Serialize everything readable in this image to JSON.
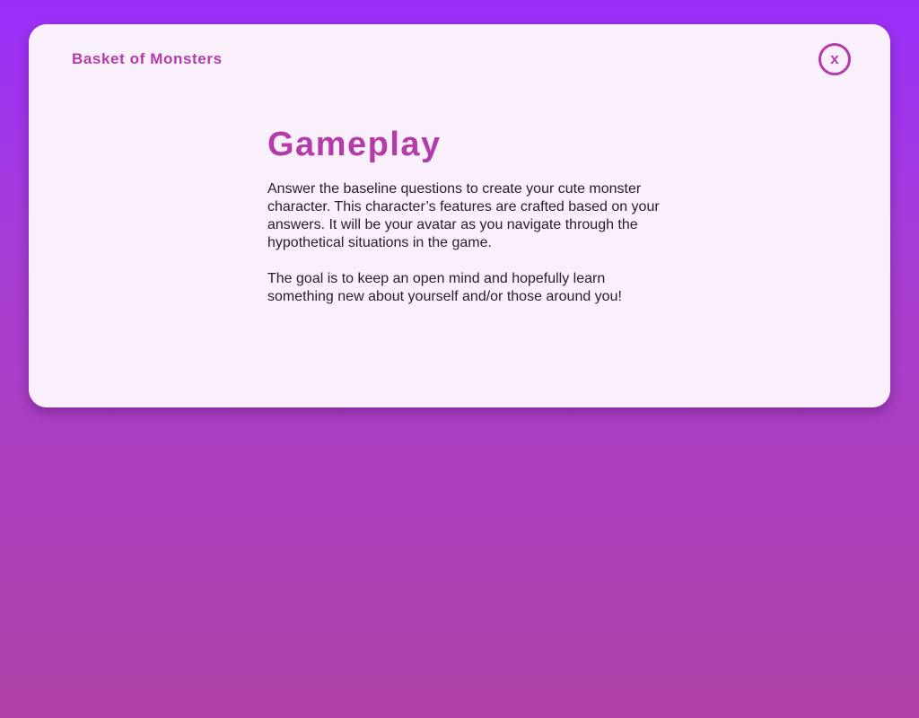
{
  "app": {
    "title": "Basket of Monsters"
  },
  "modal": {
    "close_label": "x",
    "close_icon": "close-icon",
    "heading": "Gameplay",
    "paragraphs": [
      "Answer the baseline questions to create your cute monster character. This character’s features are crafted based on your answers. It will be your avatar as you navigate through the hypothetical situations in the game.",
      "The goal is to keep an open mind and hopefully learn something new about yourself and/or those around you!"
    ]
  },
  "colors": {
    "accent": "#b43ca8",
    "background_top": "#9b2ffb",
    "background_bottom": "#b142a8",
    "modal_background": "#f9f0fb",
    "body_text": "#2b1a2f"
  }
}
